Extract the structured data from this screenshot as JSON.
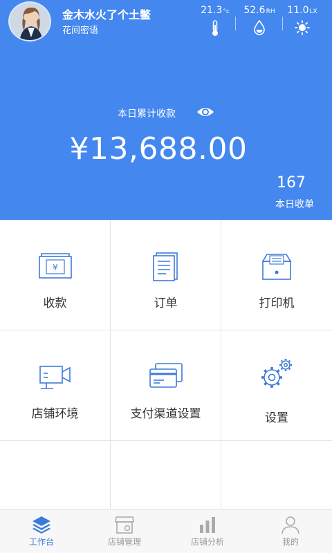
{
  "user": {
    "name": "金木水火了个土鳖",
    "subtitle": "花间密语"
  },
  "sensors": [
    {
      "value": "21.3",
      "unit": "°c",
      "icon": "thermometer-icon"
    },
    {
      "value": "52.6",
      "unit": "RH",
      "icon": "humidity-drop-icon"
    },
    {
      "value": "11.0",
      "unit": "LX",
      "icon": "sun-icon"
    }
  ],
  "summary": {
    "total_label": "本日累计收款",
    "total_amount": "¥13,688.00",
    "order_count": "167",
    "order_label": "本日收单"
  },
  "grid": [
    {
      "label": "收款",
      "icon": "receive-payment-icon"
    },
    {
      "label": "订单",
      "icon": "order-icon"
    },
    {
      "label": "打印机",
      "icon": "printer-icon"
    },
    {
      "label": "店铺环境",
      "icon": "camera-icon"
    },
    {
      "label": "支付渠道设置",
      "icon": "payment-card-icon"
    },
    {
      "label": "设置",
      "icon": "settings-gear-icon"
    }
  ],
  "tabs": [
    {
      "label": "工作台",
      "icon": "layers-icon",
      "active": true
    },
    {
      "label": "店铺管理",
      "icon": "store-icon",
      "active": false
    },
    {
      "label": "店铺分析",
      "icon": "analytics-icon",
      "active": false
    },
    {
      "label": "我的",
      "icon": "profile-icon",
      "active": false
    }
  ],
  "colors": {
    "primary": "#4387ef",
    "icon_blue": "#3d7bd9",
    "tab_inactive": "#999999"
  }
}
